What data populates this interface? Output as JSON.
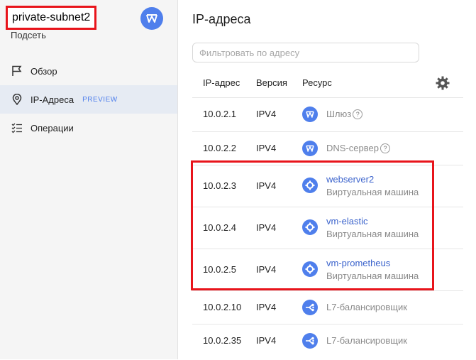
{
  "sidebar": {
    "subnet_name": "private-subnet2",
    "subnet_type": "Подсеть",
    "items": [
      {
        "label": "Обзор",
        "icon": "flag-icon"
      },
      {
        "label": "IP-Адреса",
        "icon": "location-pin-icon",
        "badge": "PREVIEW",
        "active": true
      },
      {
        "label": "Операции",
        "icon": "checklist-icon"
      }
    ]
  },
  "main": {
    "title": "IP-адреса",
    "filter_placeholder": "Фильтровать по адресу",
    "columns": [
      "IP-адрес",
      "Версия",
      "Ресурс"
    ],
    "rows": [
      {
        "ip": "10.0.2.1",
        "version": "IPV4",
        "resource": "Шлюз",
        "icon": "gateway-icon",
        "help": "?"
      },
      {
        "ip": "10.0.2.2",
        "version": "IPV4",
        "resource": "DNS-сервер",
        "icon": "gateway-icon",
        "help": "?"
      },
      {
        "ip": "10.0.2.3",
        "version": "IPV4",
        "resource": "webserver2",
        "sub": "Виртуальная машина",
        "icon": "vm-icon"
      },
      {
        "ip": "10.0.2.4",
        "version": "IPV4",
        "resource": "vm-elastic",
        "sub": "Виртуальная машина",
        "icon": "vm-icon"
      },
      {
        "ip": "10.0.2.5",
        "version": "IPV4",
        "resource": "vm-prometheus",
        "sub": "Виртуальная машина",
        "icon": "vm-icon"
      },
      {
        "ip": "10.0.2.10",
        "version": "IPV4",
        "resource": "L7-балансировщик",
        "icon": "balancer-icon"
      },
      {
        "ip": "10.0.2.35",
        "version": "IPV4",
        "resource": "L7-балансировщик",
        "icon": "balancer-icon"
      }
    ]
  },
  "colors": {
    "accent": "#4f7fec",
    "link": "#3b63cc",
    "highlight": "#e8141b",
    "sidebar_bg": "#f5f5f5"
  }
}
